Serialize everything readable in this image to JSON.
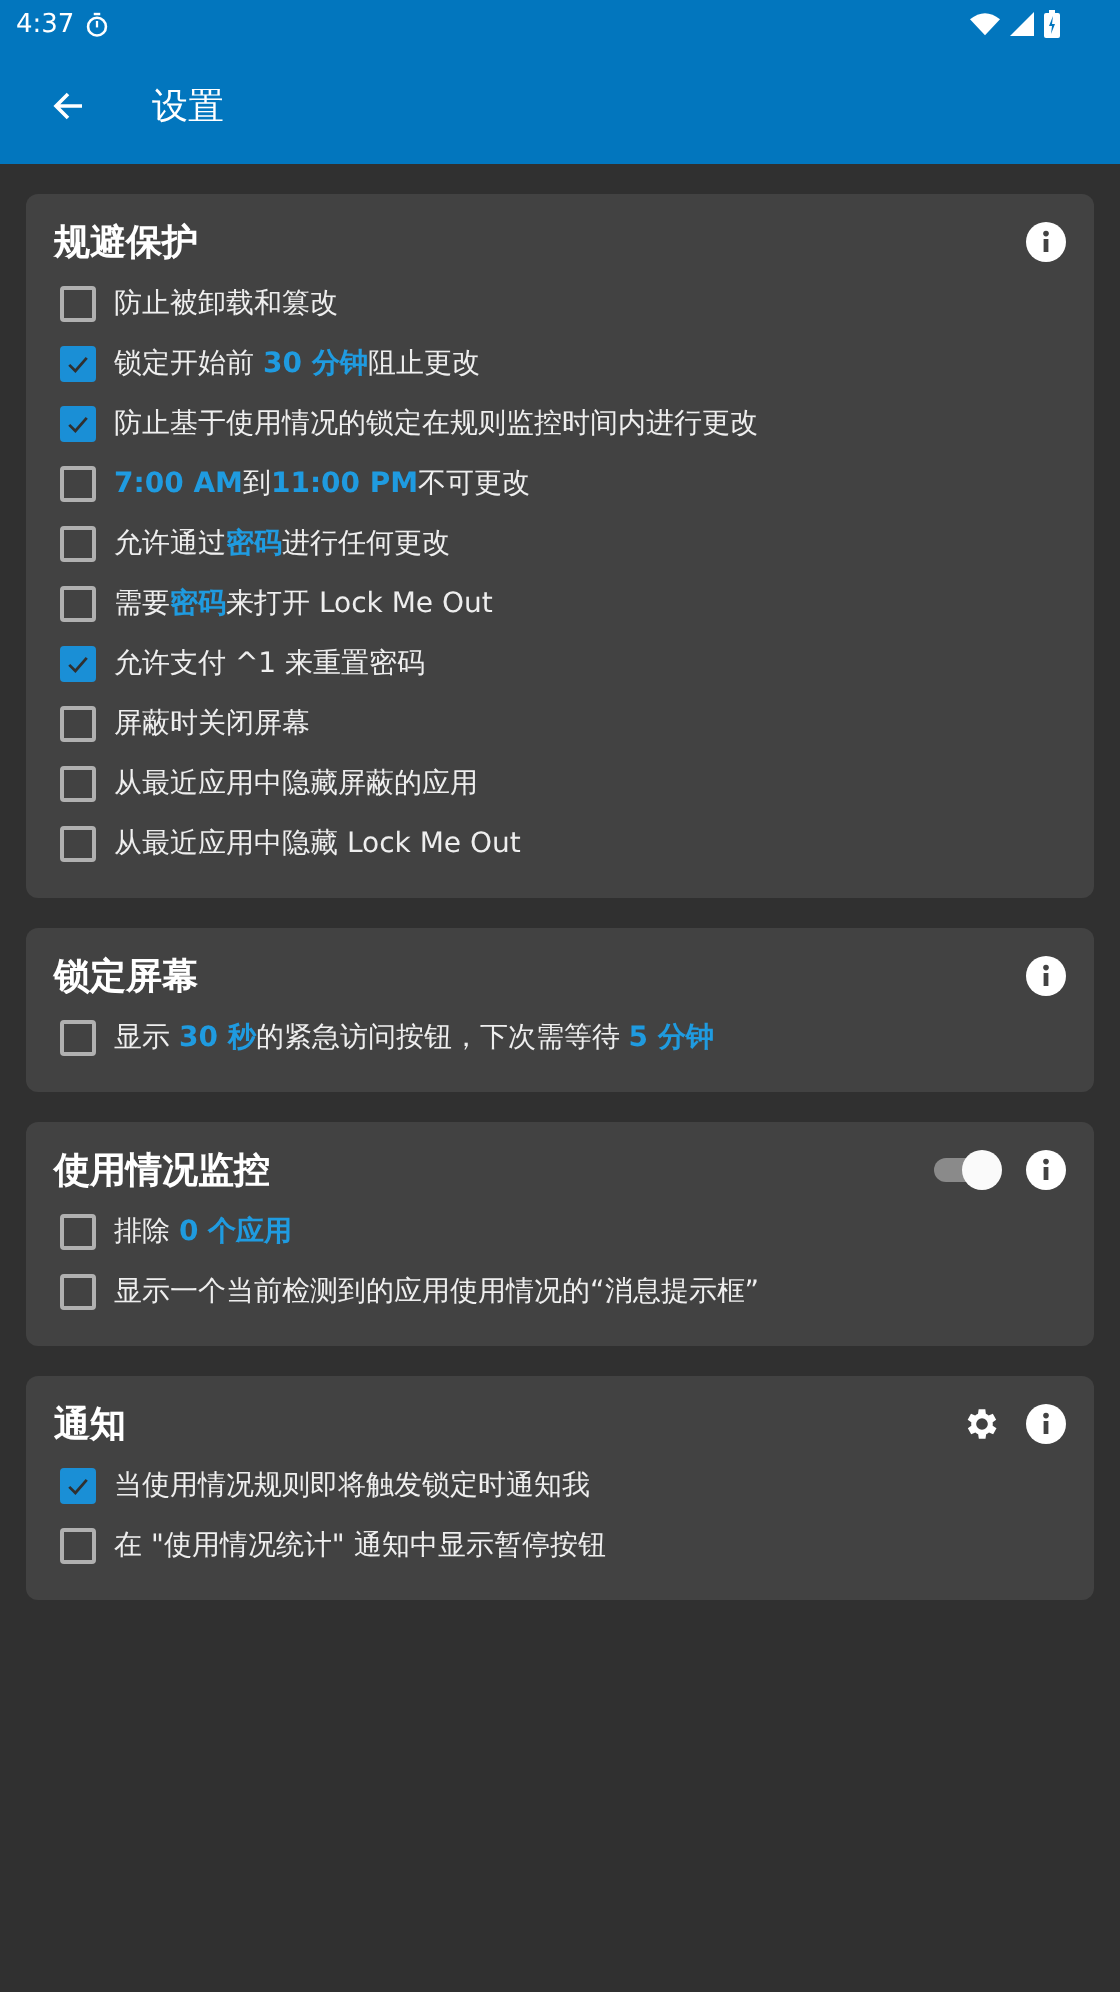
{
  "status_bar": {
    "time": "4:37"
  },
  "app_bar": {
    "title": "设置"
  },
  "sections": [
    {
      "title": "规避保护",
      "settings_icon": false,
      "options": [
        {
          "checked": false,
          "label": "防止被卸载和篡改"
        },
        {
          "checked": true,
          "label": "锁定开始前 **30 分钟**阻止更改"
        },
        {
          "checked": true,
          "label": "防止基于使用情况的锁定在规则监控时间内进行更改"
        },
        {
          "checked": false,
          "label": "**7:00 AM**到**11:00 PM**不可更改"
        },
        {
          "checked": false,
          "label": "允许通过**密码**进行任何更改"
        },
        {
          "checked": false,
          "label": "需要**密码**来打开 Lock Me Out"
        },
        {
          "checked": true,
          "label": "允许支付 ^1 来重置密码"
        },
        {
          "checked": false,
          "label": "屏蔽时关闭屏幕"
        },
        {
          "checked": false,
          "label": "从最近应用中隐藏屏蔽的应用"
        },
        {
          "checked": false,
          "label": "从最近应用中隐藏 Lock Me Out"
        }
      ]
    },
    {
      "title": "锁定屏幕",
      "settings_icon": false,
      "options": [
        {
          "checked": false,
          "label": "显示 **30 秒**的紧急访问按钮，下次需等待 **5 分钟**"
        }
      ]
    },
    {
      "title": "使用情况监控",
      "toggle": {
        "on": true
      },
      "settings_icon": false,
      "options": [
        {
          "checked": false,
          "label": "排除 **0 个应用**"
        },
        {
          "checked": false,
          "label": "显示一个当前检测到的应用使用情况的“消息提示框”"
        }
      ]
    },
    {
      "title": "通知",
      "settings_icon": true,
      "options": [
        {
          "checked": true,
          "label": "当使用情况规则即将触发锁定时通知我"
        },
        {
          "checked": false,
          "label": "在 \"使用情况统计\" 通知中显示暂停按钮"
        }
      ]
    }
  ]
}
